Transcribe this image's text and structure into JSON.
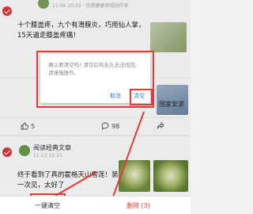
{
  "feed": {
    "card1": {
      "meta": "11-06 20:32 · 优质健康领域创作者",
      "title": "十个膝盖疼，九个有滑膜炎，巧用仙人掌，15天逼走膝盖疼痛！"
    },
    "card2": {
      "snippet": "国家安求",
      "likes": "5",
      "comments": "98"
    },
    "card3": {
      "author": "阅读经典文章",
      "meta": "11-13 12:15",
      "title": "终于看到了真的霍格天山雪莲！第一次见，太好了"
    }
  },
  "dialog": {
    "message": "确认要清空吗? 清空后将永久无法找回, 请谨慎操作。",
    "cancel_label": "取消",
    "confirm_label": "清空"
  },
  "bottom_bar": {
    "clear_all_label": "一键清空",
    "delete_label": "删除 (3)"
  },
  "colors": {
    "accent": "#e53935",
    "dialog_button": "#3a7bd5"
  },
  "icons": [
    "checkbox-checked-icon",
    "like-icon",
    "comment-icon",
    "share-icon"
  ]
}
